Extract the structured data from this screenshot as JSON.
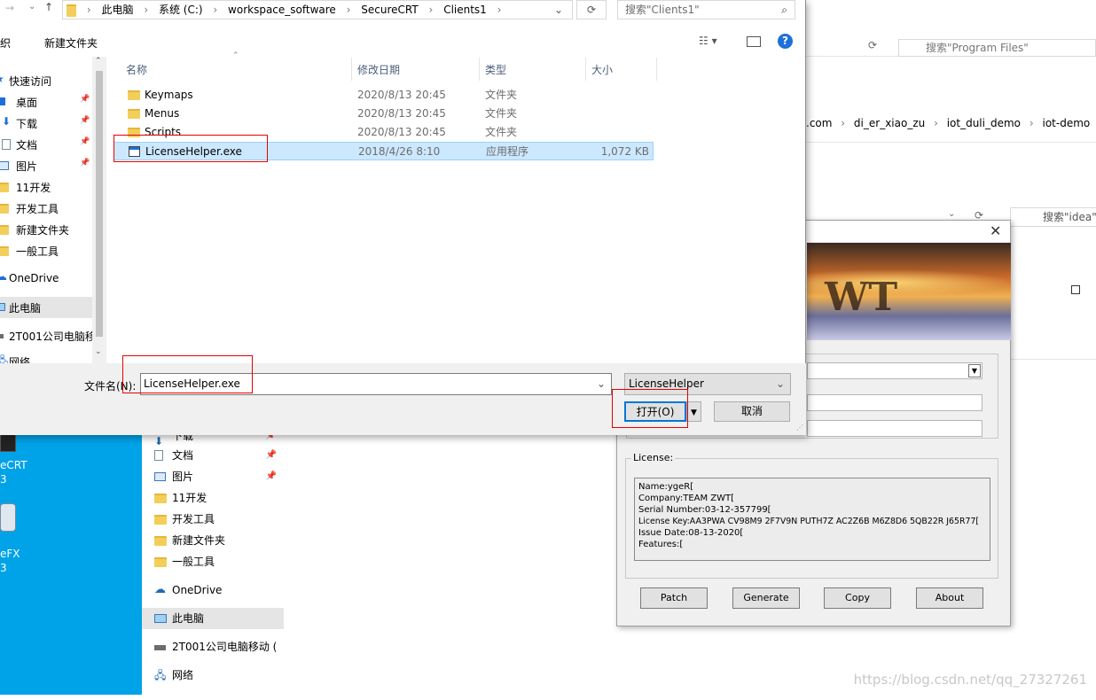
{
  "dialog": {
    "breadcrumb": [
      "此电脑",
      "系统 (C:)",
      "workspace_software",
      "SecureCRT",
      "Clients1"
    ],
    "search_placeholder": "搜索\"Clients1\"",
    "toolbar_organize": "织",
    "toolbar_new_folder": "新建文件夹",
    "sidebar": [
      {
        "label": "快速访问",
        "icon": "star-icon",
        "pinned": false
      },
      {
        "label": "桌面",
        "icon": "desktop-icon",
        "pinned": true
      },
      {
        "label": "下载",
        "icon": "download-icon",
        "pinned": true
      },
      {
        "label": "文档",
        "icon": "document-icon",
        "pinned": true
      },
      {
        "label": "图片",
        "icon": "picture-icon",
        "pinned": true
      },
      {
        "label": "11开发",
        "icon": "folder-icon",
        "pinned": false
      },
      {
        "label": "开发工具",
        "icon": "folder-icon",
        "pinned": false
      },
      {
        "label": "新建文件夹",
        "icon": "folder-icon",
        "pinned": false
      },
      {
        "label": "一般工具",
        "icon": "folder-icon",
        "pinned": false
      },
      {
        "label": "OneDrive",
        "icon": "cloud-icon",
        "pinned": false
      },
      {
        "label": "此电脑",
        "icon": "computer-icon",
        "pinned": false,
        "selected": true
      },
      {
        "label": "2T001公司电脑移",
        "icon": "drive-icon",
        "pinned": false
      },
      {
        "label": "网络",
        "icon": "network-icon",
        "pinned": false
      }
    ],
    "columns": {
      "name": "名称",
      "date": "修改日期",
      "type": "类型",
      "size": "大小"
    },
    "files": [
      {
        "name": "Keymaps",
        "date": "2020/8/13 20:45",
        "type": "文件夹",
        "size": "",
        "icon": "folder-icon"
      },
      {
        "name": "Menus",
        "date": "2020/8/13 20:45",
        "type": "文件夹",
        "size": "",
        "icon": "folder-icon"
      },
      {
        "name": "Scripts",
        "date": "2020/8/13 20:45",
        "type": "文件夹",
        "size": "",
        "icon": "folder-icon"
      },
      {
        "name": "LicenseHelper.exe",
        "date": "2018/4/26 8:10",
        "type": "应用程序",
        "size": "1,072 KB",
        "icon": "exe-icon",
        "selected": true
      }
    ],
    "filename_label": "文件名(N):",
    "filename_value": "LicenseHelper.exe",
    "filetype_value": "LicenseHelper",
    "open_button": "打开(O)",
    "cancel_button": "取消"
  },
  "bg_explorer": {
    "breadcrumb": [
      ".com",
      "di_er_xiao_zu",
      "iot_duli_demo",
      "iot-demo"
    ],
    "search1": "搜索\"Program Files\"",
    "search2": "搜索\"idea\"",
    "sidebar": [
      {
        "label": "下载",
        "pinned": true
      },
      {
        "label": "文档",
        "pinned": true
      },
      {
        "label": "图片",
        "pinned": true
      },
      {
        "label": "11开发",
        "pinned": false
      },
      {
        "label": "开发工具",
        "pinned": false
      },
      {
        "label": "新建文件夹",
        "pinned": false
      },
      {
        "label": "一般工具",
        "pinned": false
      },
      {
        "label": "OneDrive",
        "pinned": false
      },
      {
        "label": "此电脑",
        "pinned": false,
        "selected": true
      },
      {
        "label": "2T001公司电脑移动 (",
        "pinned": false
      },
      {
        "label": "网络",
        "pinned": false
      }
    ]
  },
  "desktop": {
    "icons": [
      "eCRT",
      "eFX"
    ],
    "sub": [
      "3",
      "3"
    ]
  },
  "keygen": {
    "banner_text": "WT",
    "license_group": "License:",
    "license_lines": [
      "Name:ygeR[",
      "Company:TEAM ZWT[",
      "Serial Number:03-12-357799[",
      "License Key:AA3PWA CV98M9 2F7V9N PUTH7Z AC2Z6B M6Z8D6 5QB22R J65R77[",
      "Issue Date:08-13-2020[",
      "Features:["
    ],
    "buttons": [
      "Patch",
      "Generate",
      "Copy",
      "About"
    ]
  },
  "watermark": "https://blog.csdn.net/qq_27327261"
}
